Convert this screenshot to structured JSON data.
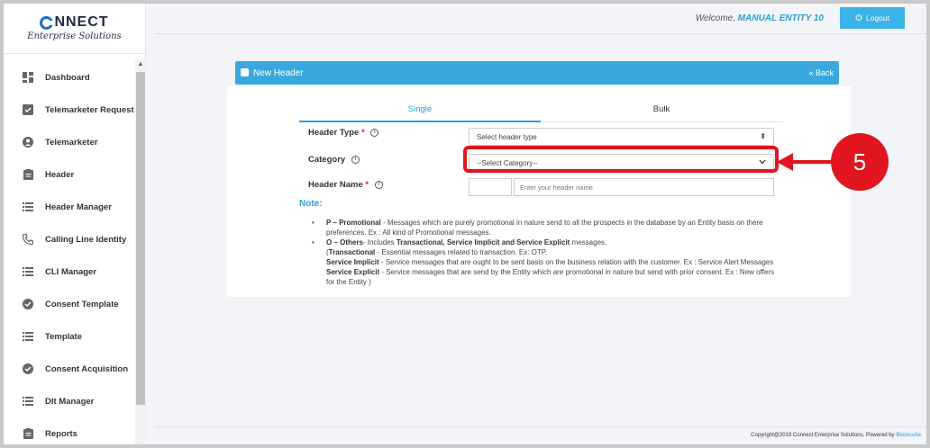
{
  "brand": {
    "name_left": "C",
    "name_right": "NNECT",
    "tagline": "Enterprise Solutions"
  },
  "sidebar": {
    "items": [
      {
        "label": "Dashboard",
        "icon": "dashboard-icon"
      },
      {
        "label": "Telemarketer Request",
        "icon": "checkbox-icon"
      },
      {
        "label": "Telemarketer",
        "icon": "user-circle-icon"
      },
      {
        "label": "Header",
        "icon": "clipboard-icon"
      },
      {
        "label": "Header Manager",
        "icon": "list-icon"
      },
      {
        "label": "Calling Line Identity",
        "icon": "phone-icon"
      },
      {
        "label": "CLI Manager",
        "icon": "list-icon"
      },
      {
        "label": "Consent Template",
        "icon": "check-circle-icon"
      },
      {
        "label": "Template",
        "icon": "list-icon"
      },
      {
        "label": "Consent Acquisition",
        "icon": "check-circle-icon"
      },
      {
        "label": "Dlt Manager",
        "icon": "list-icon"
      },
      {
        "label": "Reports",
        "icon": "clipboard-icon"
      }
    ]
  },
  "topbar": {
    "welcome_prefix": "Welcome, ",
    "user": "MANUAL ENTITY 10",
    "logout_label": "Logout"
  },
  "card": {
    "title": "New Header",
    "back_label": "Back"
  },
  "tabs": {
    "single": "Single",
    "bulk": "Bulk"
  },
  "form": {
    "header_type_label": "Header Type",
    "header_type_value": "Select header type",
    "category_label": "Category",
    "category_value": "--Select Category--",
    "header_name_label": "Header Name",
    "header_name_placeholder": "Enter your header name",
    "required_mark": "*",
    "info_glyph": "i"
  },
  "note": {
    "title": "Note:",
    "p_bold": "P – Promotional",
    "p_text": " - Messages which are purely promotional in nature send to all the prospects in the database by an Entity basis on there preferences. Ex : All kind of Promotional messages.",
    "o_bold": "O – Others",
    "o_text": "- Includes ",
    "o_bold2": "Transactional, Service Implicit and Service Explicit",
    "o_text2": " messages.",
    "t_open": "(",
    "t_bold": "Transactional",
    "t_text": " - Essential messages related to transaction. Ex: OTP.",
    "si_bold": "Service Implicit",
    "si_text": " - Service messages that are ought to be sent basis on the business relation with the customer. Ex : Service Alert Messages",
    "se_bold": "Service Explicit",
    "se_text": " - Service messages that are send by the Entity which are promotional in nature but send with prior consent. Ex : New offers for the Entity )"
  },
  "annotation": {
    "step": "5",
    "color": "#e0151f"
  },
  "footer": {
    "text": "Copyright@2019 Connect Enterprise Solutions, Powered by ",
    "powered": "Blockcube"
  }
}
